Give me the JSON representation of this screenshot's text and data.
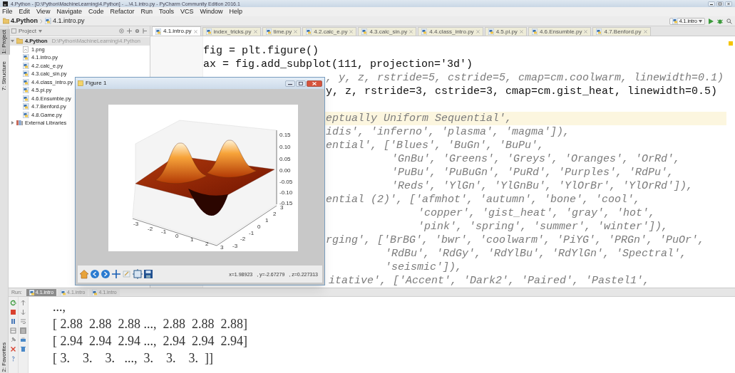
{
  "window": {
    "title": "4.Python - [D:\\Python\\MachineLearning\\4.Python] - ...\\4.1.intro.py - PyCharm Community Edition 2016.1"
  },
  "menu": [
    "File",
    "Edit",
    "View",
    "Navigate",
    "Code",
    "Refactor",
    "Run",
    "Tools",
    "VCS",
    "Window",
    "Help"
  ],
  "breadcrumbs": [
    "4.Python",
    "4.1.intro.py"
  ],
  "run_config": "4.1.intro",
  "side_tabs": [
    {
      "label": "1: Project",
      "selected": true
    },
    {
      "label": "7: Structure",
      "selected": false
    }
  ],
  "bottom_side_tab": {
    "label": "2: Favorites",
    "selected": false
  },
  "project": {
    "title": "Project",
    "tree": [
      {
        "name": "4.Python",
        "path": "D:\\Python\\MachineLearning\\4.Python",
        "kind": "folder",
        "expanded": true,
        "selected": true,
        "children": [
          {
            "name": "1.png",
            "kind": "image"
          },
          {
            "name": "4.1.intro.py",
            "kind": "python"
          },
          {
            "name": "4.2.calc_e.py",
            "kind": "python"
          },
          {
            "name": "4.3.calc_sin.py",
            "kind": "python"
          },
          {
            "name": "4.4.class_intro.py",
            "kind": "python"
          },
          {
            "name": "4.5.pi.py",
            "kind": "python"
          },
          {
            "name": "4.6.Ensumble.py",
            "kind": "python"
          },
          {
            "name": "4.7.Benford.py",
            "kind": "python"
          },
          {
            "name": "4.8.Game.py",
            "kind": "python"
          }
        ]
      },
      {
        "name": "External Libraries",
        "kind": "library",
        "expanded": false,
        "selected": false
      }
    ]
  },
  "tabs": [
    {
      "label": "4.1.intro.py",
      "selected": true
    },
    {
      "label": "index_tricks.py",
      "selected": false
    },
    {
      "label": "time.py",
      "selected": false
    },
    {
      "label": "4.2.calc_e.py",
      "selected": false
    },
    {
      "label": "4.3.calc_sin.py",
      "selected": false
    },
    {
      "label": "4.4.class_intro.py",
      "selected": false
    },
    {
      "label": "4.5.pi.py",
      "selected": false
    },
    {
      "label": "4.6.Ensumble.py",
      "selected": false
    },
    {
      "label": "4.7.Benford.py",
      "selected": false
    }
  ],
  "editor_lines": [
    {
      "kind": "code",
      "text": "fig = plt.figure()",
      "current": false
    },
    {
      "kind": "code",
      "text": "ax = fig.add_subplot(111, projection='3d')",
      "current": false
    },
    {
      "kind": "comment",
      "text": ", y, z, rstride=5, cstride=5, cmap=cm.coolwarm, linewidth=0.1)",
      "current": false
    },
    {
      "kind": "code",
      "text": "y, z, rstride=3, cstride=3, cmap=cm.gist_heat, linewidth=0.5)",
      "current": false
    },
    {
      "kind": "blank",
      "current": false
    },
    {
      "kind": "comment",
      "text": "eptually Uniform Sequential',",
      "current": true
    },
    {
      "kind": "comment",
      "text": "idis', 'inferno', 'plasma', 'magma']),",
      "current": false
    },
    {
      "kind": "comment",
      "text": "ential', ['Blues', 'BuGn', 'BuPu',",
      "current": false
    },
    {
      "kind": "comment",
      "text": "'GnBu', 'Greens', 'Greys', 'Oranges', 'OrRd',",
      "current": false
    },
    {
      "kind": "comment",
      "text": "'PuBu', 'PuBuGn', 'PuRd', 'Purples', 'RdPu',",
      "current": false
    },
    {
      "kind": "comment",
      "text": "'Reds', 'YlGn', 'YlGnBu', 'YlOrBr', 'YlOrRd']),",
      "current": false
    },
    {
      "kind": "comment",
      "text": "ential (2)', ['afmhot', 'autumn', 'bone', 'cool',",
      "current": false
    },
    {
      "kind": "comment",
      "text": "'copper', 'gist_heat', 'gray', 'hot',",
      "current": false
    },
    {
      "kind": "comment",
      "text": "'pink', 'spring', 'summer', 'winter']),",
      "current": false
    },
    {
      "kind": "comment",
      "text": "rging', ['BrBG', 'bwr', 'coolwarm', 'PiYG', 'PRGn', 'PuOr',",
      "current": false
    },
    {
      "kind": "comment",
      "text": "'RdBu', 'RdGy', 'RdYlBu', 'RdYlGn', 'Spectral',",
      "current": false
    },
    {
      "kind": "comment",
      "text": "'seismic']),",
      "current": false
    },
    {
      "kind": "comment",
      "text": "itative', ['Accent', 'Dark2', 'Paired', 'Pastel1',",
      "current": false
    }
  ],
  "figure": {
    "title": "Figure 1",
    "z_ticks": [
      "0.15",
      "0.10",
      "0.05",
      "0.00",
      "-0.05",
      "-0.10",
      "-0.15"
    ],
    "x_ticks": [
      "-3",
      "-2",
      "-1",
      "0",
      "1",
      "2",
      "3"
    ],
    "y_ticks": [
      "3",
      "2",
      "1",
      "0",
      "-1",
      "-2",
      "-3"
    ],
    "status": [
      "x=1.98923",
      ", y=-2.67279",
      ", z=0.227313"
    ]
  },
  "run": {
    "label": "Run:",
    "tabs": [
      {
        "label": "4.1.intro",
        "selected": true
      },
      {
        "label": "4.1.intro",
        "selected": false
      },
      {
        "label": "4.1.intro",
        "selected": false
      }
    ],
    "output": [
      "...,",
      "[ 2.88  2.88  2.88 ...,  2.88  2.88  2.88]",
      "[ 2.94  2.94  2.94 ...,  2.94  2.94  2.94]",
      "[ 3.    3.    3.   ...,  3.    3.    3.  ]]"
    ]
  }
}
